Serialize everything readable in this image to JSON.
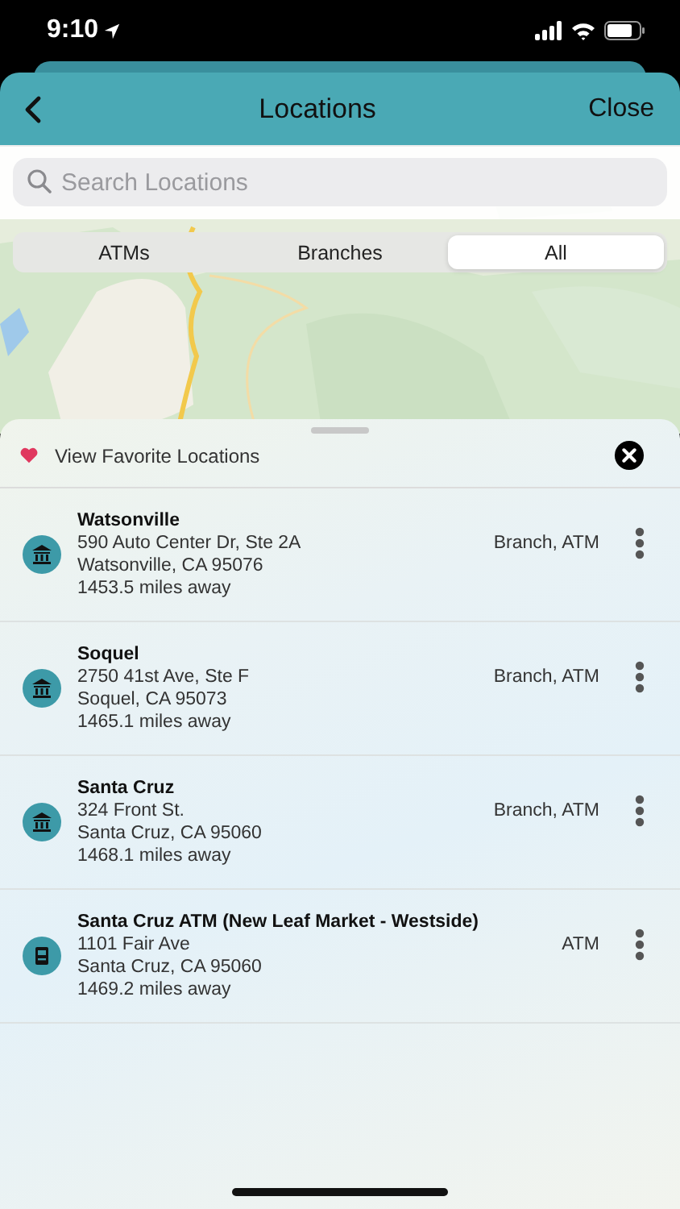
{
  "status_bar": {
    "time": "9:10"
  },
  "header": {
    "title": "Locations",
    "close": "Close"
  },
  "search": {
    "placeholder": "Search Locations"
  },
  "tabs": [
    {
      "label": "ATMs",
      "selected": false
    },
    {
      "label": "Branches",
      "selected": false
    },
    {
      "label": "All",
      "selected": true
    }
  ],
  "favorites": {
    "label": "View Favorite Locations"
  },
  "locations": [
    {
      "kind": "branch",
      "name": "Watsonville",
      "address": "590 Auto Center Dr, Ste 2A",
      "city": "Watsonville, CA 95076",
      "distance": "1453.5 miles away",
      "type": "Branch, ATM"
    },
    {
      "kind": "branch",
      "name": "Soquel",
      "address": "2750 41st Ave, Ste F",
      "city": "Soquel, CA 95073",
      "distance": "1465.1 miles away",
      "type": "Branch, ATM"
    },
    {
      "kind": "branch",
      "name": "Santa Cruz",
      "address": "324 Front St.",
      "city": "Santa Cruz, CA 95060",
      "distance": "1468.1 miles away",
      "type": "Branch, ATM"
    },
    {
      "kind": "atm",
      "name": "Santa Cruz ATM (New Leaf Market - Westside)",
      "address": "1101 Fair Ave",
      "city": "Santa Cruz, CA 95060",
      "distance": "1469.2 miles away",
      "type": "ATM"
    }
  ]
}
